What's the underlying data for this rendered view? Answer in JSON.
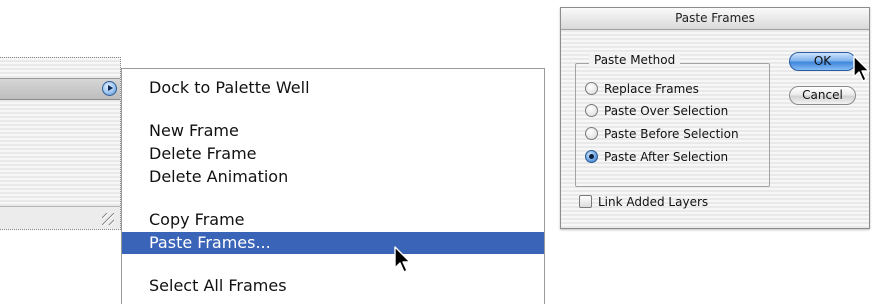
{
  "palette": {
    "menu_button_icon": "circle-arrow-right-icon",
    "resize_icon": "resize-grip-icon"
  },
  "menu": {
    "dock_label": "Dock to Palette Well",
    "new_frame_label": "New Frame",
    "delete_frame_label": "Delete Frame",
    "delete_animation_label": "Delete Animation",
    "copy_frame_label": "Copy Frame",
    "paste_frames_label": "Paste Frames...",
    "select_all_label": "Select All Frames",
    "highlight_color": "#3a64b8"
  },
  "dialog": {
    "title": "Paste Frames",
    "group_label": "Paste Method",
    "options": [
      {
        "label": "Replace Frames",
        "selected": false
      },
      {
        "label": "Paste Over Selection",
        "selected": false
      },
      {
        "label": "Paste Before Selection",
        "selected": false
      },
      {
        "label": "Paste After Selection",
        "selected": true
      }
    ],
    "link_layers_label": "Link Added Layers",
    "link_layers_checked": false,
    "ok_label": "OK",
    "cancel_label": "Cancel",
    "default_button_color": "#3f86dc"
  },
  "cursor_icon": "arrow-pointer-icon"
}
